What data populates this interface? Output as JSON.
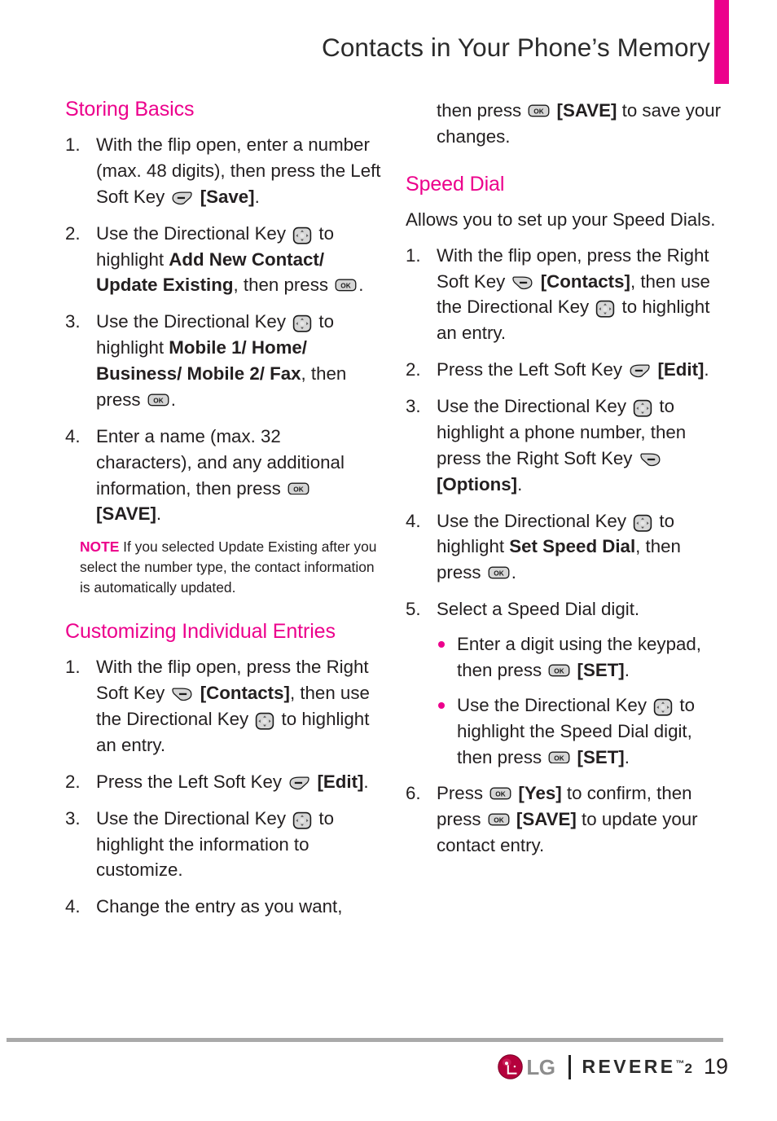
{
  "header": {
    "title": "Contacts in Your Phone’s Memory",
    "accent_color": "#ec008c"
  },
  "icons": {
    "left_soft_key": "left-soft-key-icon",
    "right_soft_key": "right-soft-key-icon",
    "directional_key": "directional-key-icon",
    "ok_key": "ok-key-icon"
  },
  "left_column": {
    "sections": [
      {
        "heading": "Storing Basics",
        "steps": [
          {
            "num": "1.",
            "parts": [
              {
                "t": "With the flip open, enter a number (max. 48 digits), then press the Left Soft Key "
              },
              {
                "icon": "left_soft_key"
              },
              {
                "t": " "
              },
              {
                "t": "[Save]",
                "b": true
              },
              {
                "t": "."
              }
            ]
          },
          {
            "num": "2.",
            "parts": [
              {
                "t": "Use the Directional Key "
              },
              {
                "icon": "directional_key"
              },
              {
                "t": " to highlight "
              },
              {
                "t": "Add New Contact/ Update Existing",
                "b": true
              },
              {
                "t": ", then press "
              },
              {
                "icon": "ok_key"
              },
              {
                "t": "."
              }
            ]
          },
          {
            "num": "3.",
            "parts": [
              {
                "t": "Use the Directional Key "
              },
              {
                "icon": "directional_key"
              },
              {
                "t": " to highlight "
              },
              {
                "t": "Mobile 1/ Home/ Business/ Mobile 2/ Fax",
                "b": true
              },
              {
                "t": ", then press "
              },
              {
                "icon": "ok_key"
              },
              {
                "t": "."
              }
            ]
          },
          {
            "num": "4.",
            "parts": [
              {
                "t": "Enter a name (max. 32 characters), and any additional information, then press "
              },
              {
                "icon": "ok_key"
              },
              {
                "t": " "
              },
              {
                "t": "[SAVE]",
                "b": true
              },
              {
                "t": "."
              }
            ]
          }
        ],
        "note": {
          "label": "NOTE",
          "text": "If you selected Update Existing after you select the number type, the contact information is automatically updated."
        }
      },
      {
        "heading": "Customizing Individual Entries",
        "steps": [
          {
            "num": "1.",
            "parts": [
              {
                "t": "With the flip open, press the Right Soft Key "
              },
              {
                "icon": "right_soft_key"
              },
              {
                "t": " "
              },
              {
                "t": "[Contacts]",
                "b": true
              },
              {
                "t": ", then use the Directional Key "
              },
              {
                "icon": "directional_key"
              },
              {
                "t": " to highlight an entry."
              }
            ]
          },
          {
            "num": "2.",
            "parts": [
              {
                "t": "Press the Left Soft Key "
              },
              {
                "icon": "left_soft_key"
              },
              {
                "t": " "
              },
              {
                "t": "[Edit]",
                "b": true
              },
              {
                "t": "."
              }
            ]
          },
          {
            "num": "3.",
            "parts": [
              {
                "t": "Use the Directional Key "
              },
              {
                "icon": "directional_key"
              },
              {
                "t": " to highlight the information to customize."
              }
            ]
          },
          {
            "num": "4.",
            "parts": [
              {
                "t": "Change the entry as you want,"
              }
            ]
          }
        ]
      }
    ]
  },
  "right_column": {
    "continuation": {
      "parts": [
        {
          "t": "then press "
        },
        {
          "icon": "ok_key"
        },
        {
          "t": " "
        },
        {
          "t": "[SAVE]",
          "b": true
        },
        {
          "t": " to save your changes."
        }
      ]
    },
    "sections": [
      {
        "heading": "Speed Dial",
        "intro": "Allows you to set up your Speed Dials.",
        "steps": [
          {
            "num": "1.",
            "parts": [
              {
                "t": "With the flip open, press the Right Soft Key "
              },
              {
                "icon": "right_soft_key"
              },
              {
                "t": " "
              },
              {
                "t": "[Contacts]",
                "b": true
              },
              {
                "t": ", then use the Directional Key "
              },
              {
                "icon": "directional_key"
              },
              {
                "t": " to highlight an entry."
              }
            ]
          },
          {
            "num": "2.",
            "parts": [
              {
                "t": "Press the Left Soft Key "
              },
              {
                "icon": "left_soft_key"
              },
              {
                "t": " "
              },
              {
                "t": "[Edit]",
                "b": true
              },
              {
                "t": "."
              }
            ]
          },
          {
            "num": "3.",
            "parts": [
              {
                "t": "Use the Directional Key "
              },
              {
                "icon": "directional_key"
              },
              {
                "t": " to highlight a phone number, then press the Right Soft Key "
              },
              {
                "icon": "right_soft_key"
              },
              {
                "t": " "
              },
              {
                "t": "[Options]",
                "b": true
              },
              {
                "t": "."
              }
            ]
          },
          {
            "num": "4.",
            "parts": [
              {
                "t": "Use the Directional Key "
              },
              {
                "icon": "directional_key"
              },
              {
                "t": " to highlight "
              },
              {
                "t": "Set Speed Dial",
                "b": true
              },
              {
                "t": ", then press "
              },
              {
                "icon": "ok_key"
              },
              {
                "t": "."
              }
            ]
          },
          {
            "num": "5.",
            "parts": [
              {
                "t": "Select a Speed Dial digit."
              }
            ],
            "substeps": [
              {
                "parts": [
                  {
                    "t": "Enter a digit using the keypad, then press "
                  },
                  {
                    "icon": "ok_key"
                  },
                  {
                    "t": " "
                  },
                  {
                    "t": "[SET]",
                    "b": true
                  },
                  {
                    "t": "."
                  }
                ]
              },
              {
                "parts": [
                  {
                    "t": "Use the Directional Key "
                  },
                  {
                    "icon": "directional_key"
                  },
                  {
                    "t": " to highlight the Speed Dial digit, then press "
                  },
                  {
                    "icon": "ok_key"
                  },
                  {
                    "t": " "
                  },
                  {
                    "t": "[SET]",
                    "b": true
                  },
                  {
                    "t": "."
                  }
                ]
              }
            ]
          },
          {
            "num": "6.",
            "parts": [
              {
                "t": "Press "
              },
              {
                "icon": "ok_key"
              },
              {
                "t": " "
              },
              {
                "t": "[Yes]",
                "b": true
              },
              {
                "t": " to confirm, then press "
              },
              {
                "icon": "ok_key"
              },
              {
                "t": " "
              },
              {
                "t": "[SAVE]",
                "b": true
              },
              {
                "t": " to update your contact entry."
              }
            ]
          }
        ]
      }
    ]
  },
  "footer": {
    "brand_lg": "LG",
    "brand_model": "REVERE",
    "brand_model_tm": "™",
    "brand_model_num": "2",
    "page_number": "19"
  }
}
